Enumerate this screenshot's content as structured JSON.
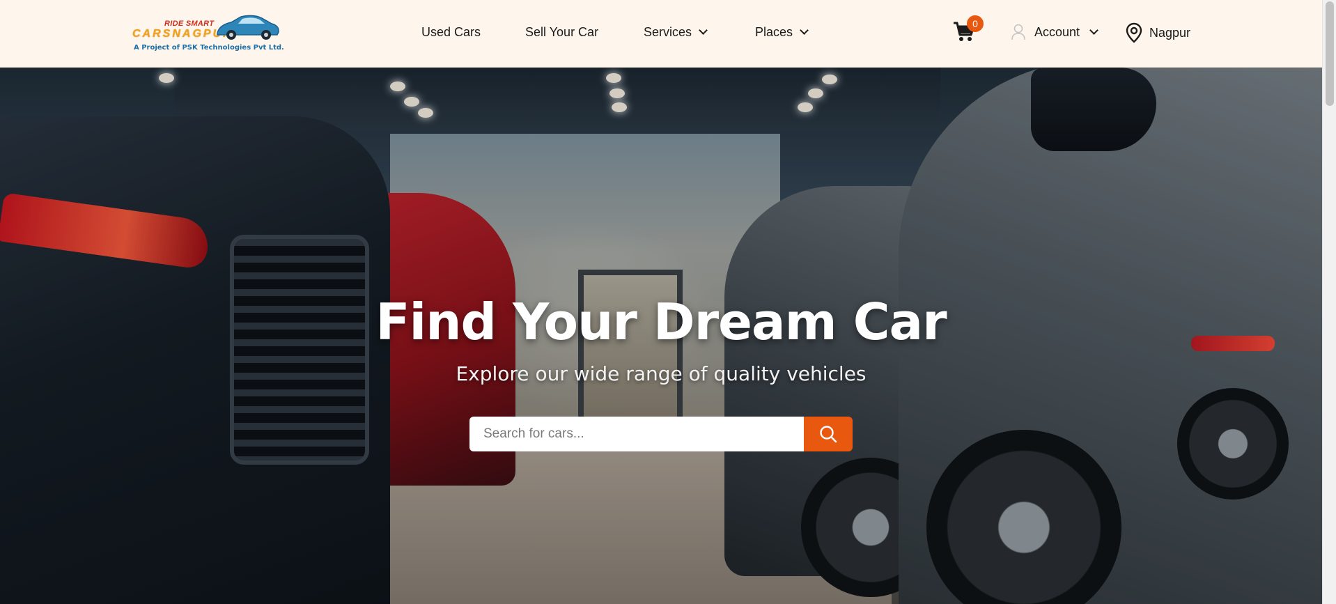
{
  "header": {
    "logo": {
      "tagline": "RIDE SMART",
      "brand": "CARSNAGPUR",
      "subtitle": "A Project of PSK Technologies Pvt Ltd."
    },
    "nav": [
      {
        "label": "Used Cars"
      },
      {
        "label": "Sell Your Car"
      },
      {
        "label": "Services",
        "has_dropdown": true
      },
      {
        "label": "Places",
        "has_dropdown": true
      }
    ],
    "cart": {
      "count": "0",
      "icon": "cart-icon"
    },
    "account": {
      "label": "Account",
      "icon": "user-icon"
    },
    "location": {
      "label": "Nagpur",
      "icon": "map-pin-icon"
    }
  },
  "hero": {
    "title": "Find Your Dream Car",
    "subtitle": "Explore our wide range of quality vehicles",
    "search": {
      "placeholder": "Search for cars...",
      "value": "",
      "button_icon": "search-icon"
    }
  },
  "colors": {
    "header_bg": "#fef6ec",
    "accent": "#e8580e",
    "text": "#1b1b1b"
  }
}
